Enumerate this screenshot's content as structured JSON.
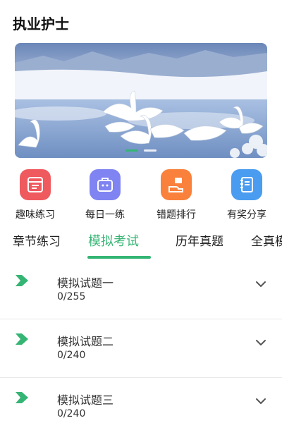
{
  "header": {
    "title": "执业护士"
  },
  "banner": {
    "slides": [
      "slide-1",
      "slide-2"
    ],
    "active_slide": 1,
    "accent": "#35b574"
  },
  "shortcuts": [
    {
      "label": "趣味练习",
      "icon": "practice-icon",
      "color": "#ef5a5f"
    },
    {
      "label": "每日一练",
      "icon": "calendar-briefcase-icon",
      "color": "#7f84f2"
    },
    {
      "label": "错题排行",
      "icon": "ranking-hand-icon",
      "color": "#f9813b"
    },
    {
      "label": "有奖分享",
      "icon": "share-book-icon",
      "color": "#4a9cf0"
    }
  ],
  "tabs": [
    {
      "label": "章节练习",
      "active": false
    },
    {
      "label": "模拟考试",
      "active": true
    },
    {
      "label": "历年真题",
      "active": false
    },
    {
      "label": "全真模",
      "active": false
    }
  ],
  "exams": [
    {
      "name": "模拟试题一",
      "progress": "0/255"
    },
    {
      "name": "模拟试题二",
      "progress": "0/240"
    },
    {
      "name": "模拟试题三",
      "progress": "0/240"
    }
  ],
  "colors": {
    "accent": "#35b574",
    "text": "#222222",
    "divider": "#e9e9e9"
  }
}
